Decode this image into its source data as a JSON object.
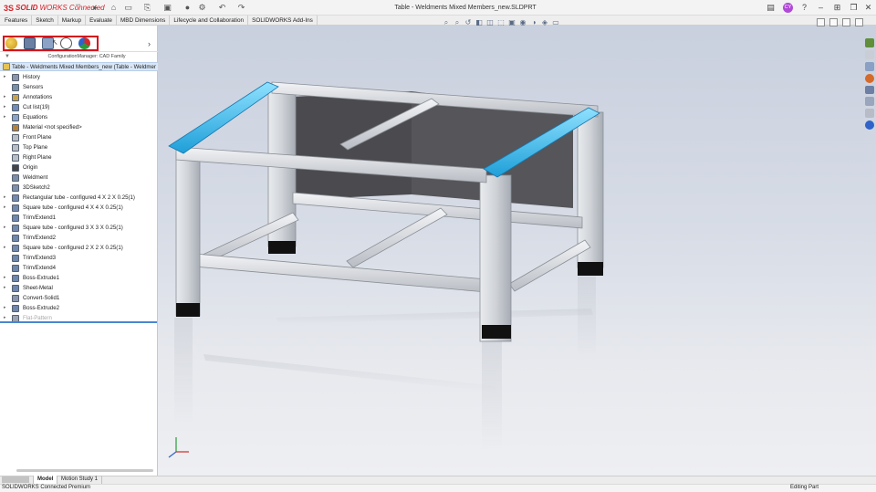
{
  "app": {
    "logo_ds": "3S",
    "logo_solid": "SOLID",
    "logo_works_connected": "WORKS Connected",
    "document_title": "Table - Weldments Mixed Members_new.SLDPRT"
  },
  "command_tabs": [
    "Features",
    "Sketch",
    "Markup",
    "Evaluate",
    "MBD Dimensions",
    "Lifecycle and Collaboration",
    "SOLIDWORKS Add-Ins"
  ],
  "feature_manager": {
    "config_label": "ConfigurationManager: CAD Family",
    "root_label": "Table - Weldments Mixed Members_new (Table - Weldments Mixed",
    "tree": [
      {
        "label": "History",
        "expand": true
      },
      {
        "label": "Sensors",
        "expand": false
      },
      {
        "label": "Annotations",
        "expand": true
      },
      {
        "label": "Cut list(19)",
        "expand": true
      },
      {
        "label": "Equations",
        "expand": true
      },
      {
        "label": "Material <not specified>",
        "expand": false
      },
      {
        "label": "Front Plane",
        "expand": false
      },
      {
        "label": "Top Plane",
        "expand": false
      },
      {
        "label": "Right Plane",
        "expand": false
      },
      {
        "label": "Origin",
        "expand": false
      },
      {
        "label": "Weldment",
        "expand": false
      },
      {
        "label": "3DSketch2",
        "expand": false
      },
      {
        "label": "Rectangular tube - configured 4 X 2 X 0.25(1)",
        "expand": true
      },
      {
        "label": "Square tube - configured 4 X 4 X 0.25(1)",
        "expand": true
      },
      {
        "label": "Trim/Extend1",
        "expand": false
      },
      {
        "label": "Square tube - configured 3 X 3 X 0.25(1)",
        "expand": true
      },
      {
        "label": "Trim/Extend2",
        "expand": false
      },
      {
        "label": "Square tube - configured 2 X 2 X 0.25(1)",
        "expand": true
      },
      {
        "label": "Trim/Extend3",
        "expand": false
      },
      {
        "label": "Trim/Extend4",
        "expand": false
      },
      {
        "label": "Boss-Extrude1",
        "expand": true
      },
      {
        "label": "Sheet-Metal",
        "expand": true
      },
      {
        "label": "Convert-Solid1",
        "expand": false
      },
      {
        "label": "Boss-Extrude2",
        "expand": true
      },
      {
        "label": "Flat-Pattern",
        "expand": true,
        "grey": true
      }
    ]
  },
  "user_initials": "CY",
  "bottom_tabs": [
    "Model",
    "Motion Study 1"
  ],
  "status": {
    "left": "SOLIDWORKS Connected Premium",
    "right": "Editing Part"
  },
  "colors": {
    "accent_red": "#d4141c",
    "selection_blue": "#2fb4ea",
    "tube_grey": "#dcdfe3"
  }
}
